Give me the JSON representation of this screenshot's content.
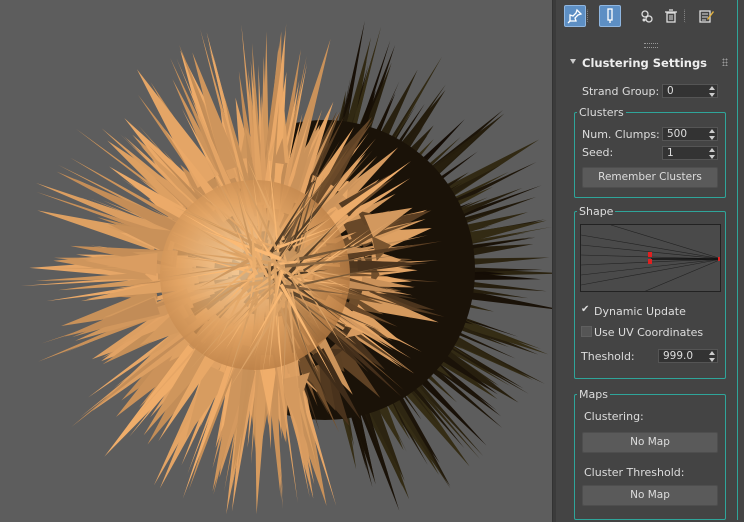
{
  "toolbar": {
    "buttons": [
      {
        "icon": "pin-icon",
        "active": true
      },
      {
        "icon": "modifier-stack-icon",
        "active": true
      },
      {
        "icon": "make-unique-icon",
        "active": false
      },
      {
        "icon": "trash-icon",
        "active": false
      },
      {
        "icon": "configure-icon",
        "active": false
      }
    ]
  },
  "rollout": {
    "title": "Clustering Settings",
    "strand_group": {
      "label": "Strand Group:",
      "value": "0"
    },
    "clusters": {
      "title": "Clusters",
      "num_clumps": {
        "label": "Num. Clumps:",
        "value": "500"
      },
      "seed": {
        "label": "Seed:",
        "value": "1"
      },
      "remember_button": "Remember Clusters"
    },
    "shape": {
      "title": "Shape",
      "dynamic_update": {
        "label": "Dynamic Update",
        "checked": true
      },
      "use_uv": {
        "label": "Use UV Coordinates",
        "checked": false
      },
      "threshold": {
        "label": "Theshold:",
        "value": "999.0"
      }
    },
    "maps": {
      "title": "Maps",
      "clustering": {
        "label": "Clustering:",
        "button": "No Map"
      },
      "cluster_threshold": {
        "label": "Cluster Threshold:",
        "button": "No Map"
      }
    }
  },
  "colors": {
    "accent": "#2fa59a",
    "viewport_bg": "#5d5d5d",
    "fur_light": "#e8a96a",
    "fur_shadow": "#1a1208"
  }
}
